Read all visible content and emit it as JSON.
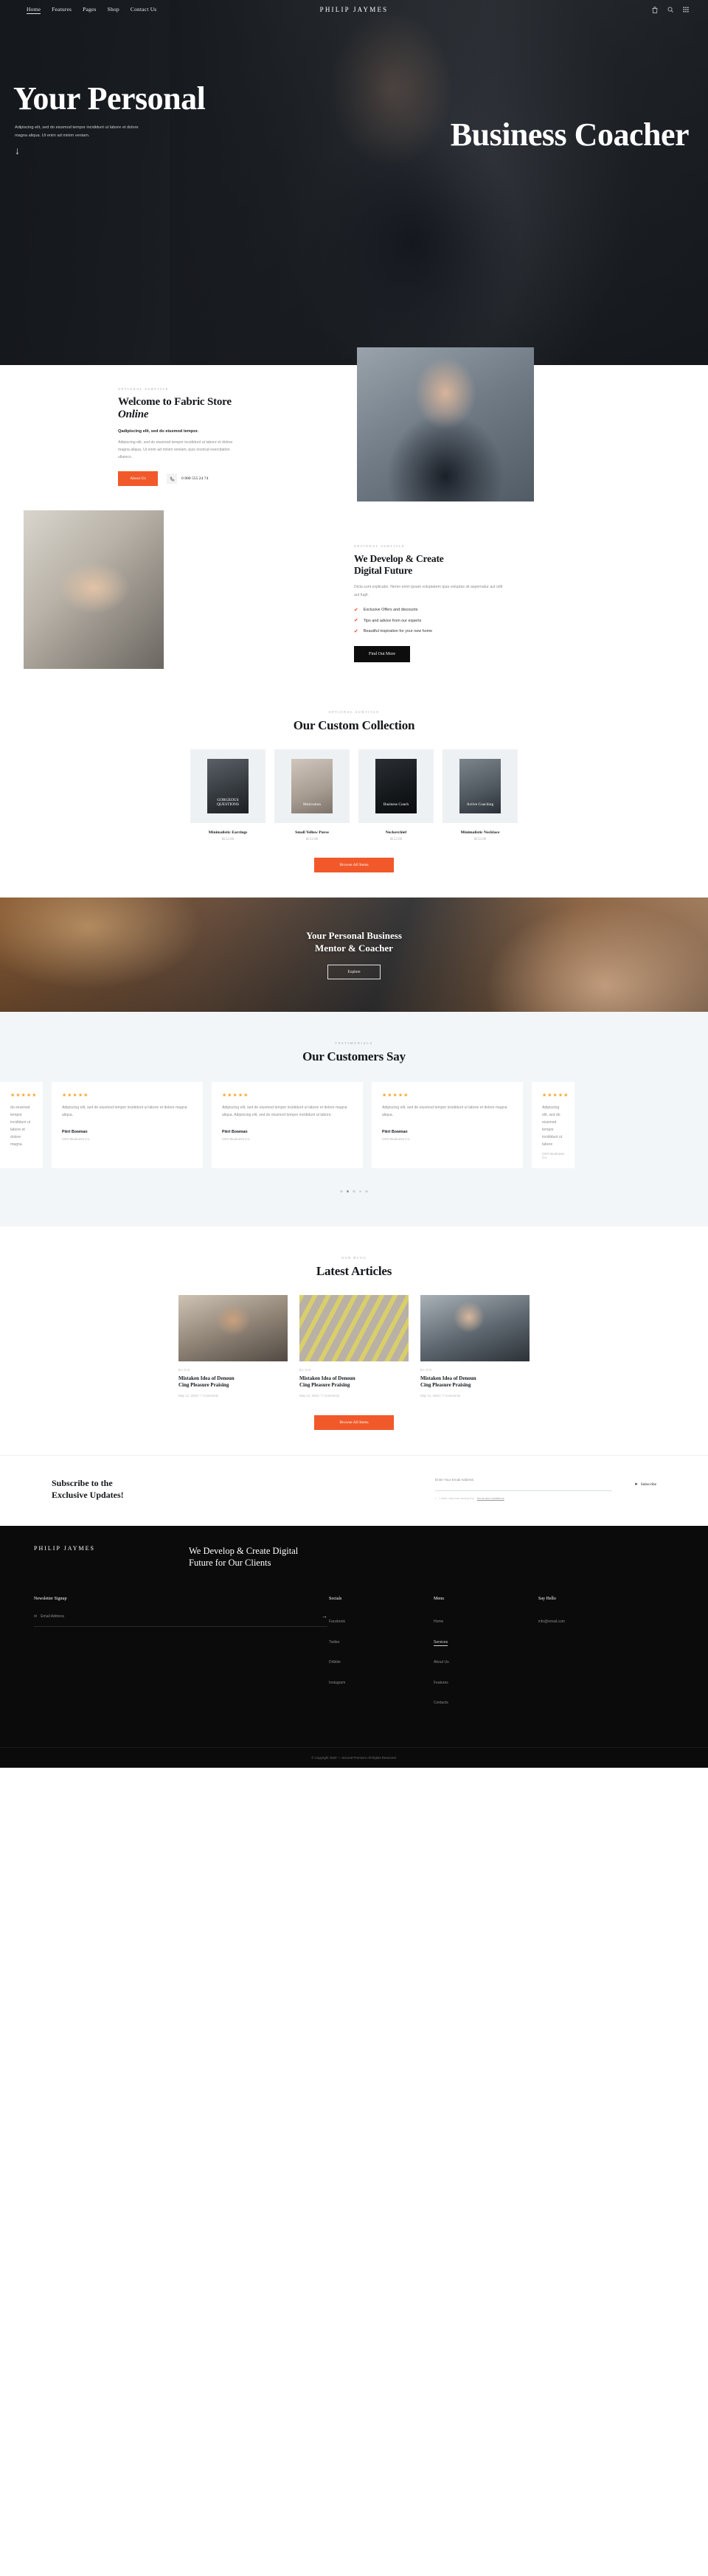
{
  "header": {
    "brand": "PHILIP JAYMES",
    "nav": [
      {
        "label": "Home",
        "active": true
      },
      {
        "label": "Features",
        "active": false
      },
      {
        "label": "Pages",
        "active": false
      },
      {
        "label": "Shop",
        "active": false
      },
      {
        "label": "Contact Us",
        "active": false
      }
    ],
    "icons": [
      "cart-icon",
      "search-icon",
      "grid-menu-icon"
    ]
  },
  "hero": {
    "line1": "Your Personal",
    "line2": "Business Coacher",
    "subtitle": "Adipiscing elit, sed do eiusmod tempor incididunt ut labore et dolore magna aliqua. Ut enim ad minim veniam.",
    "scroll_arrow": "↓"
  },
  "welcome": {
    "eyebrow": "OPTIONAL SUBTITLE",
    "title_plain": "Welcome to Fabric Store ",
    "title_italic": "Online",
    "lead": "Qadipiscing elit, sed do eiusmod tempor.",
    "body": "Adipiscing elit, sed do eiusmod tempor incididunt ut labore et dolore magna aliqua. Ut enim ad minim veniam, quis nostrud exercitation ullamco .",
    "button": "About Us",
    "phone": "0 800 555 24 74",
    "phone_icon": "phone-icon"
  },
  "develop": {
    "eyebrow": "OPTIONAL SUBTITLE",
    "title_line1": "We Develop & Create",
    "title_line2": "Digital Future",
    "body": "Dicta sunt explicabo. Nemo enim ipsam voluptatem quia voluptas sit aspernatur aut odit aut fugit.",
    "features": [
      "Exclusive Offers and discounts",
      "Tips and advice from our experts",
      "Beautiful inspiration for your new home"
    ],
    "button": "Find Out More"
  },
  "collection": {
    "eyebrow": "OPTIONAL SUBTITLE",
    "title": "Our Custom Collection",
    "products": [
      {
        "name": "Minimalistic Earrings",
        "price": "$152.00",
        "caption": "GORGEOUS QUESTIONS"
      },
      {
        "name": "Small Yellow Purse",
        "price": "$152.00",
        "caption": "Motivation"
      },
      {
        "name": "Neckerchief",
        "price": "$152.00",
        "caption": "Business Coach"
      },
      {
        "name": "Minimalistic Necklace",
        "price": "$152.00",
        "caption": "Active Coaching"
      }
    ],
    "button": "Browse All Items"
  },
  "banner": {
    "line1": "Your Personal Business",
    "line2": "Mentor & Coacher",
    "button": "Explore"
  },
  "testimonials": {
    "eyebrow": "TESTIMONIALS",
    "title": "Our Customers Say",
    "stars": "★★★★★",
    "cards": [
      {
        "body": "do eiusmod tempor incididunt ut labore et dolore magna.",
        "name": "",
        "role": "",
        "edge": true
      },
      {
        "body": "Adipiscing elit, sed do eiusmod tempor incididunt ut labore et dolore magna aliqua.",
        "name": "Piërt Bowman",
        "role": "CEO Business Co.",
        "edge": false
      },
      {
        "body": "Adipiscing elit, sed do eiusmod tempor incididunt ut labore et dolore magna aliqua. Adipiscing elit, sed do eiusmod tempor incididunt ut labore.",
        "name": "Piërt Bowman",
        "role": "CEO Business Co.",
        "edge": false
      },
      {
        "body": "Adipiscing elit, sed do eiusmod tempor incididunt ut labore et dolore magna aliqua.",
        "name": "Piërt Bowman",
        "role": "CEO Business Co.",
        "edge": false
      },
      {
        "body": "Adipiscing elit, sed do eiusmod tempor incididunt ut labore",
        "name": "CEO Business Co.",
        "role": "",
        "edge": true
      }
    ],
    "dots": [
      false,
      true,
      false,
      false,
      false
    ]
  },
  "blog": {
    "eyebrow": "OUR BLOG",
    "title": "Latest Articles",
    "posts": [
      {
        "tag": "BLOG",
        "title_line1": "Mistaken Idea of Denoun",
        "title_line2": "Cing Pleasure Praising",
        "meta": "May 12, 2020   /   7 Comments"
      },
      {
        "tag": "BLOG",
        "title_line1": "Mistaken Idea of Denoun",
        "title_line2": "Cing Pleasure Praising",
        "meta": "May 12, 2020   /   7 Comments"
      },
      {
        "tag": "BLOG",
        "title_line1": "Mistaken Idea of Denoun",
        "title_line2": "Cing Pleasure Praising",
        "meta": "May 12, 2020   /   7 Comments"
      }
    ],
    "button": "Browse All Items"
  },
  "subscribe": {
    "title_line1": "Subscribe to the",
    "title_line2": "Exclusive Updates!",
    "field_placeholder": "Enter Your Email Address",
    "note_prefix": "I have read and accept the",
    "note_link": "terms and conditions",
    "button": "Subscribe",
    "button_icon": "send-icon"
  },
  "footer": {
    "brand": "PHILIP JAYMES",
    "claim_line1": "We Develop & Create Digital",
    "claim_line2": "Future for Our Clients",
    "newsletter_heading": "Newsletter Signup",
    "newsletter_placeholder": "Email Address",
    "newsletter_icon": "mail-icon",
    "newsletter_submit_icon": "arrow-right-icon",
    "columns": [
      {
        "heading": "Socials",
        "links": [
          {
            "label": "Facebook",
            "active": false
          },
          {
            "label": "Twitter",
            "active": false
          },
          {
            "label": "Dribble",
            "active": false
          },
          {
            "label": "Instagram",
            "active": false
          }
        ]
      },
      {
        "heading": "Menu",
        "links": [
          {
            "label": "Home",
            "active": false
          },
          {
            "label": "Services",
            "active": true
          },
          {
            "label": "About Us",
            "active": false
          },
          {
            "label": "Features",
            "active": false
          },
          {
            "label": "Contacts",
            "active": false
          }
        ]
      },
      {
        "heading": "Say Hello",
        "links": [
          {
            "label": "info@email.com",
            "active": false
          }
        ]
      }
    ],
    "copyright": "© Copyright 2020 — Second Premium All Rights Reserved."
  },
  "colors": {
    "accent_orange": "#f1592a",
    "dark": "#0b0b0b",
    "star_gold": "#f7a733",
    "tick_red": "#ef4b2b"
  }
}
